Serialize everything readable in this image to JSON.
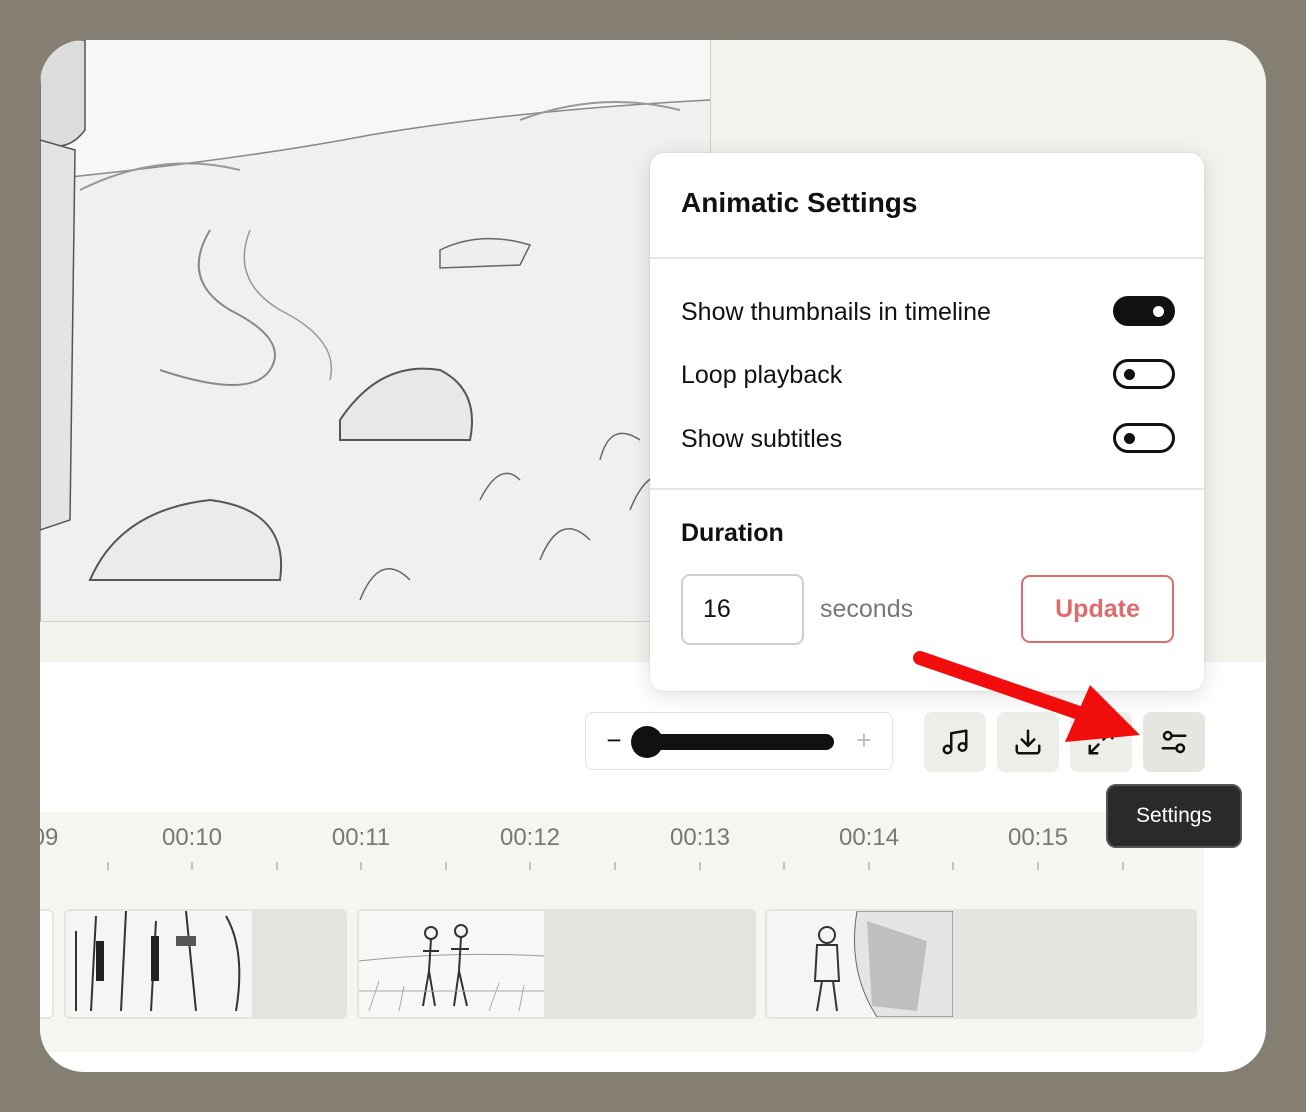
{
  "settings_panel": {
    "title": "Animatic Settings",
    "toggles": [
      {
        "label": "Show thumbnails in timeline",
        "on": true
      },
      {
        "label": "Loop playback",
        "on": false
      },
      {
        "label": "Show subtitles",
        "on": false
      }
    ],
    "duration": {
      "label": "Duration",
      "value": "16",
      "unit": "seconds",
      "update_label": "Update"
    }
  },
  "zoom": {
    "minus": "−",
    "plus": "+",
    "level": 0.05
  },
  "toolbar": {
    "buttons": [
      "music-icon",
      "download-icon",
      "expand-icon",
      "settings-sliders-icon"
    ],
    "tooltip": "Settings"
  },
  "timeline": {
    "ticks": [
      "09",
      "00:10",
      "00:11",
      "00:12",
      "00:13",
      "00:14",
      "00:15"
    ]
  },
  "colors": {
    "outer_background": "#857f73",
    "accent_red": "#e06b6b",
    "toggle_on": "#111111"
  }
}
